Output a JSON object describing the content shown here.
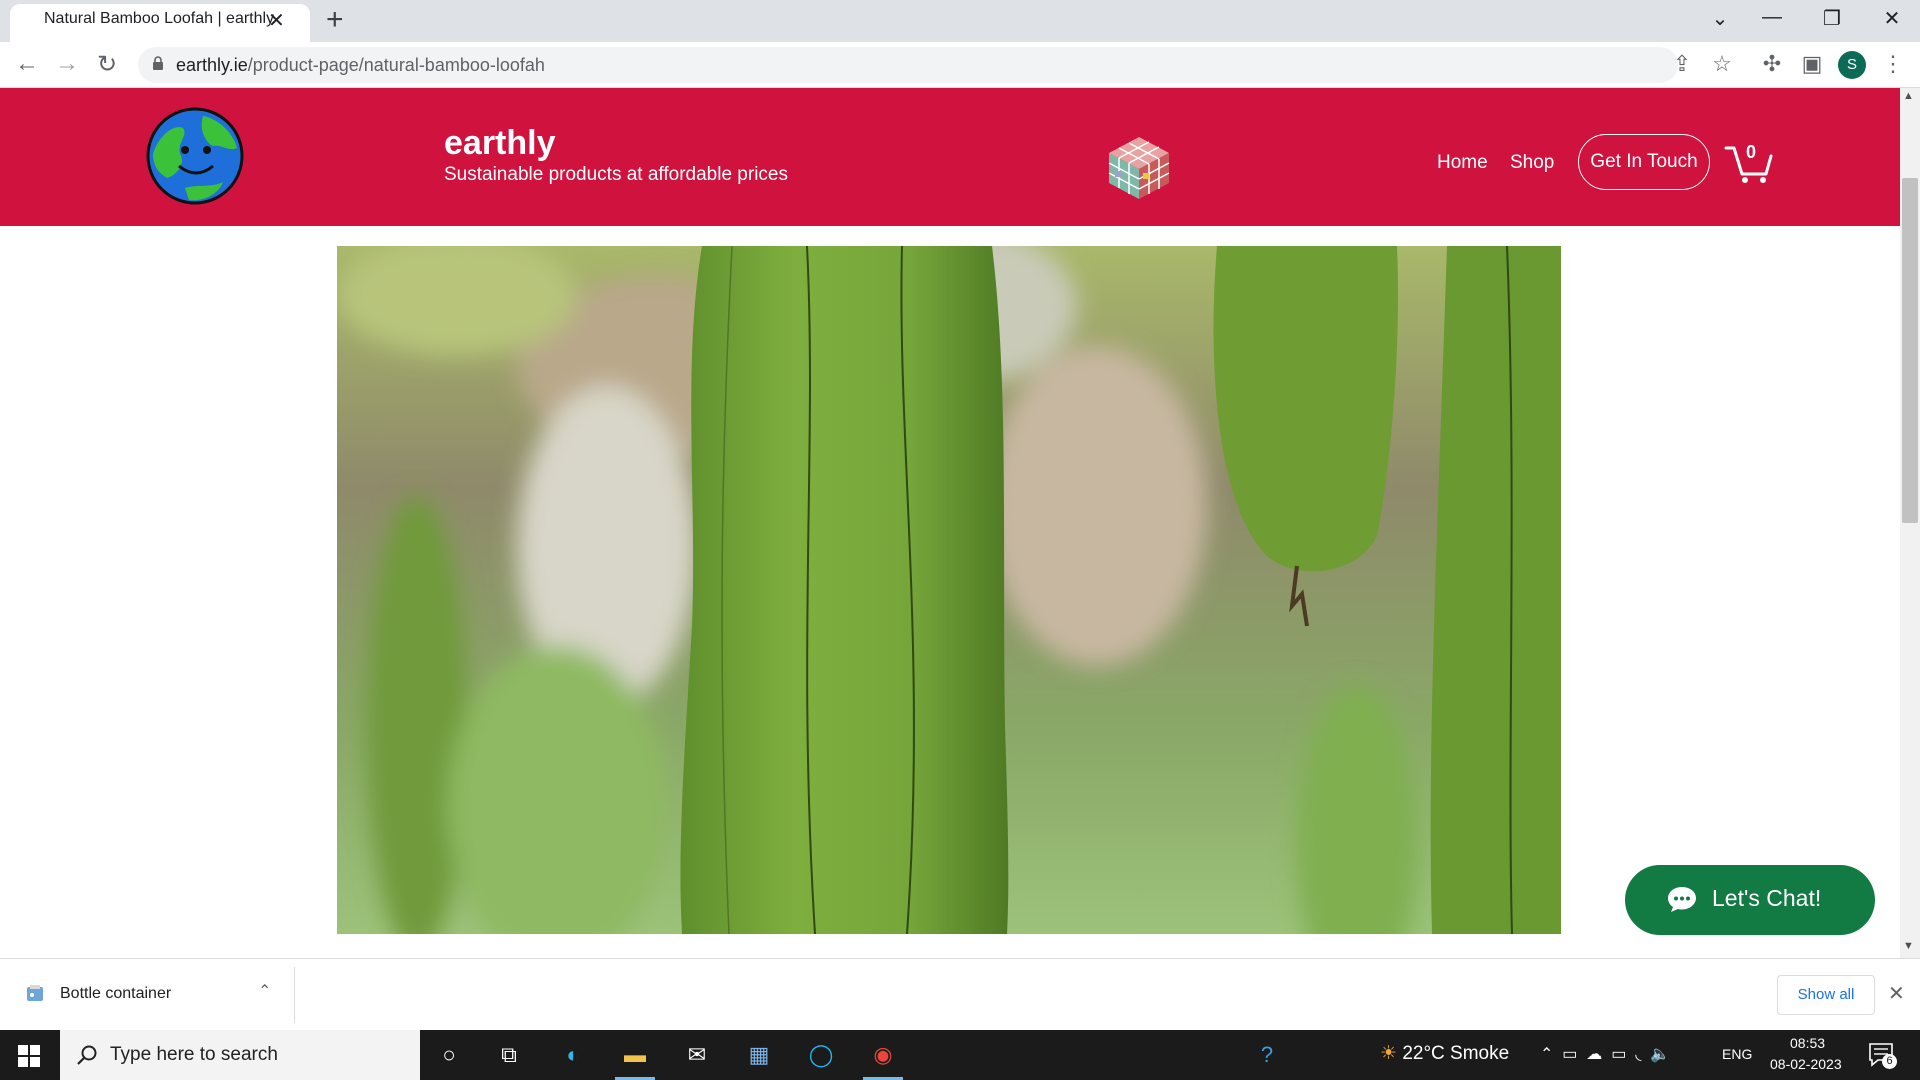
{
  "browser": {
    "tab_title": "Natural Bamboo Loofah | earthly",
    "url_host": "earthly.ie",
    "url_path": "/product-page/natural-bamboo-loofah",
    "profile_initial": "S"
  },
  "site": {
    "brand": "earthly",
    "tagline": "Sustainable products at affordable prices",
    "nav": {
      "home": "Home",
      "shop": "Shop",
      "contact": "Get In Touch"
    },
    "cart_count": "0",
    "chat_label": "Let's Chat!",
    "header_color": "#d0123f",
    "chat_color": "#127a43"
  },
  "download_shelf": {
    "file_name": "Bottle container",
    "show_all": "Show all"
  },
  "taskbar": {
    "search_placeholder": "Type here to search",
    "weather": "22°C  Smoke",
    "language": "ENG",
    "time": "08:53",
    "date": "08-02-2023",
    "notification_count": "6"
  }
}
